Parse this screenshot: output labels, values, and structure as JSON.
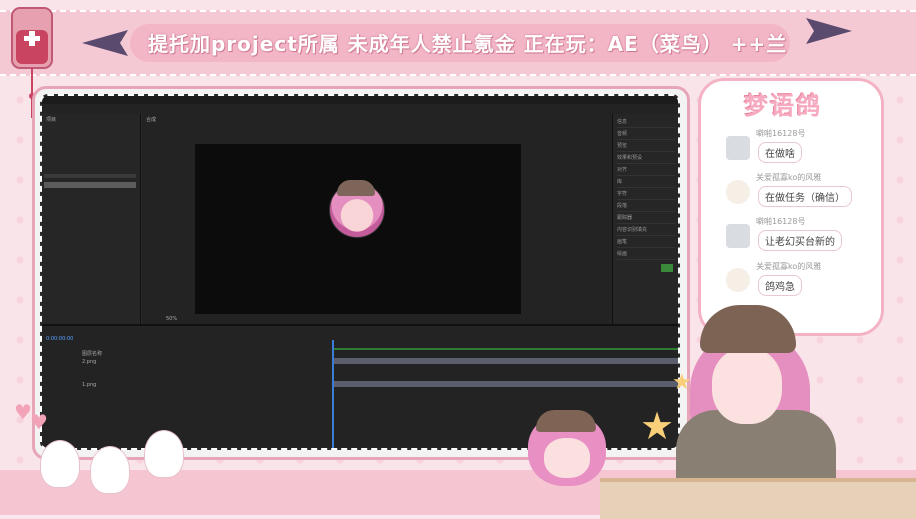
{
  "banner": {
    "title": "提托加project所属  未成年人禁止氪金  正在玩：AE（菜鸟）  ++兰"
  },
  "chat": {
    "title": "梦语鸽",
    "messages": [
      {
        "name": "噼啪16128号",
        "text": "在做啥",
        "avatar": "bili-tv-icon"
      },
      {
        "name": "关爱孤寡ko的风雅",
        "text": "在做任务（确信）",
        "avatar": "chicken-icon"
      },
      {
        "name": "噼啪16128号",
        "text": "让老幻买台新的",
        "avatar": "bili-tv-icon"
      },
      {
        "name": "关爱孤寡ko的风雅",
        "text": "鸽鸡急",
        "avatar": "chicken-icon"
      }
    ]
  },
  "ae": {
    "project_tab": "项目",
    "comp_tab": "合成",
    "timeline_time": "0:00:00:00",
    "layer_header": "图层名称",
    "layers": [
      "2.png",
      "1.png"
    ],
    "right_panel_items": [
      "信息",
      "音频",
      "预览",
      "效果和预设",
      "对齐",
      "库",
      "字符",
      "段落",
      "跟踪器",
      "内容识别填充",
      "画笔",
      "绘画"
    ],
    "zoom": "50%"
  }
}
